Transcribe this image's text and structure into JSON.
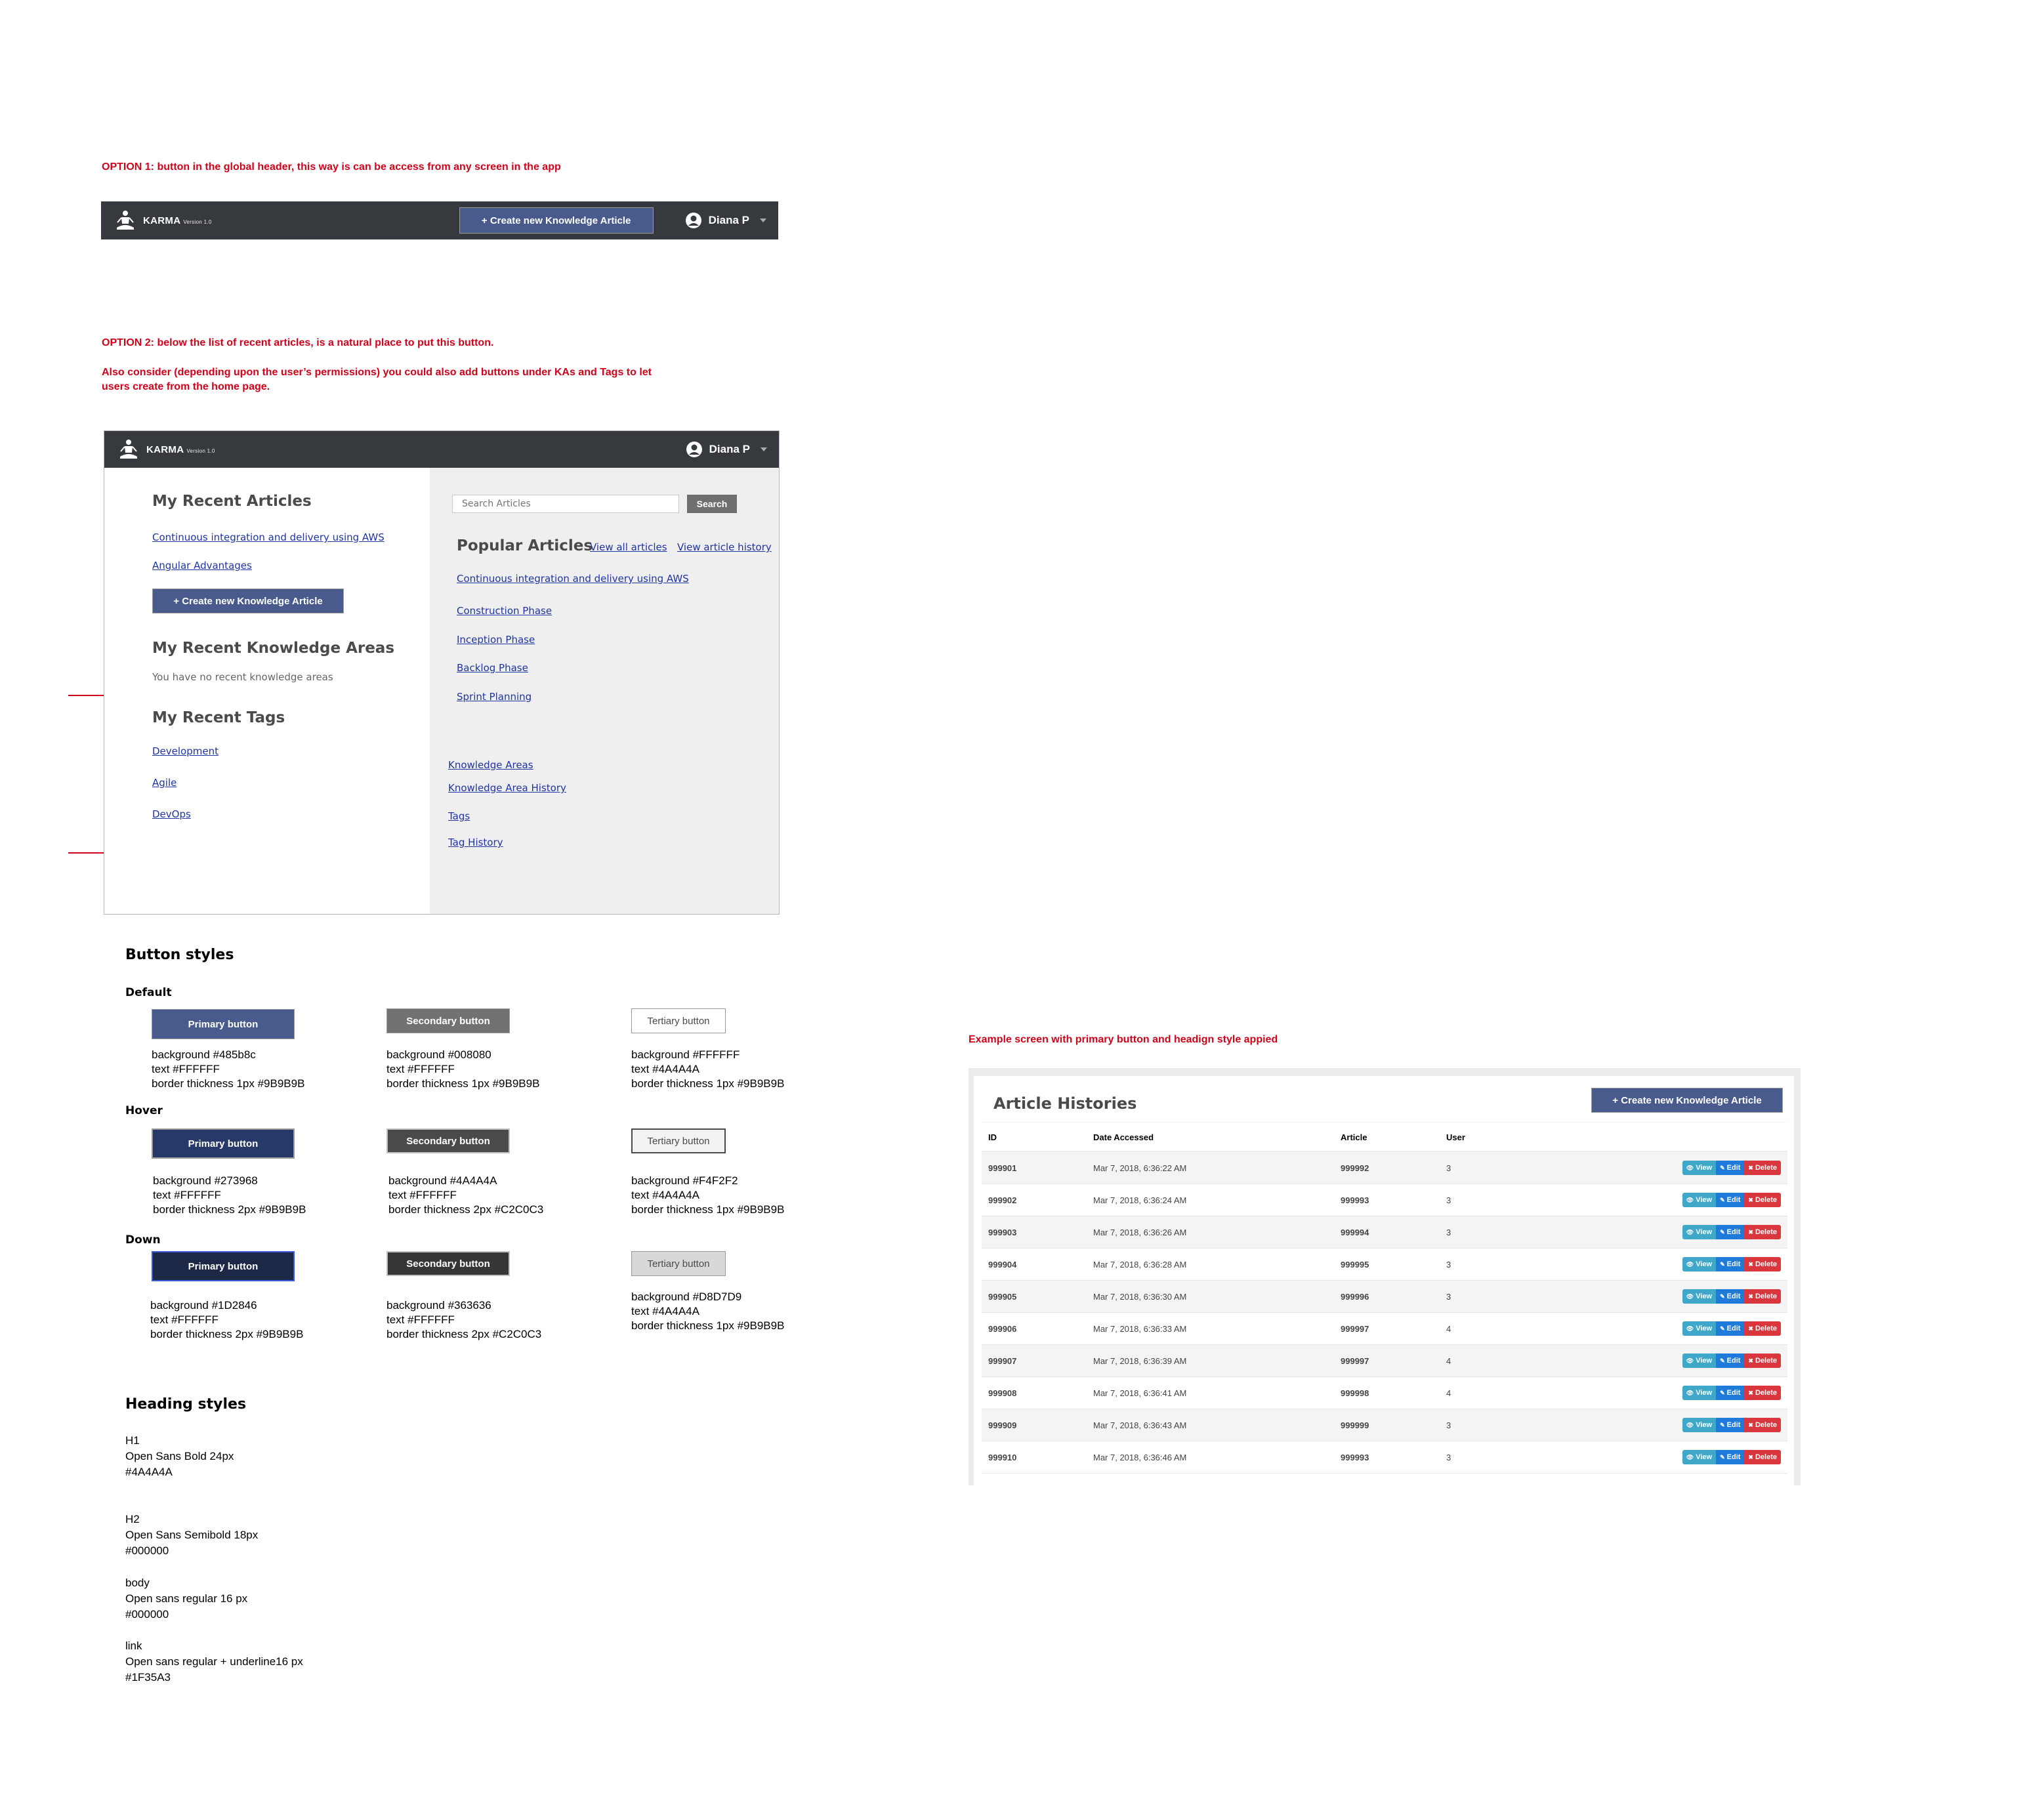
{
  "option1": {
    "note": "OPTION 1: button in the global header, this way is can be access from any screen in the app",
    "header": {
      "brand": "KARMA",
      "version": "Version 1.0",
      "create_button": "+ Create new Knowledge Article",
      "user_name": "Diana P"
    }
  },
  "option2": {
    "note_line1": "OPTION 2: below the list of recent articles, is a natural place to put this button.",
    "note_line2": "Also consider (depending upon the user’s permissions) you could also add buttons under KAs and Tags to let",
    "note_line3": "users create from the home page.",
    "header": {
      "brand": "KARMA",
      "version": "Version 1.0",
      "user_name": "Diana P"
    },
    "left": {
      "recent_articles_title": "My Recent Articles",
      "recent_articles": [
        "Continuous integration and delivery using AWS",
        "Angular Advantages"
      ],
      "create_button": "+ Create new Knowledge Article",
      "recent_areas_title": "My Recent Knowledge Areas",
      "recent_areas_empty": "You have no recent knowledge areas",
      "recent_tags_title": "My Recent Tags",
      "recent_tags": [
        "Development",
        "Agile",
        "DevOps"
      ]
    },
    "right": {
      "search_placeholder": "Search Articles",
      "search_button": "Search",
      "popular_title": "Popular Articles",
      "view_all": "View all articles",
      "view_history": "View article history",
      "popular_articles": [
        "Continuous integration and delivery using AWS",
        "Construction Phase",
        "Inception Phase",
        "Backlog Phase",
        "Sprint Planning"
      ],
      "footer_links": [
        "Knowledge Areas",
        "Knowledge Area History",
        "Tags",
        "Tag History"
      ]
    }
  },
  "button_styles": {
    "title": "Button styles",
    "states": [
      {
        "name": "Default",
        "primary": {
          "label": "Primary button",
          "spec": [
            "background #485b8c",
            "text #FFFFFF",
            "border thickness 1px #9B9B9B"
          ]
        },
        "secondary": {
          "label": "Secondary button",
          "spec": [
            "background #008080",
            "text #FFFFFF",
            "border thickness 1px #9B9B9B"
          ]
        },
        "tertiary": {
          "label": "Tertiary button",
          "spec": [
            "background #FFFFFF",
            "text #4A4A4A",
            "border thickness 1px #9B9B9B"
          ]
        }
      },
      {
        "name": "Hover",
        "primary": {
          "label": "Primary button",
          "spec": [
            "background #273968",
            "text #FFFFFF",
            "border thickness 2px #9B9B9B"
          ]
        },
        "secondary": {
          "label": "Secondary button",
          "spec": [
            "background #4A4A4A",
            "text #FFFFFF",
            "border thickness 2px #C2C0C3"
          ]
        },
        "tertiary": {
          "label": "Tertiary button",
          "spec": [
            "background #F4F2F2",
            "text #4A4A4A",
            "border thickness 1px #9B9B9B"
          ]
        }
      },
      {
        "name": "Down",
        "primary": {
          "label": "Primary button",
          "spec": [
            "background #1D2846",
            "text #FFFFFF",
            "border thickness 2px #9B9B9B"
          ]
        },
        "secondary": {
          "label": "Secondary button",
          "spec": [
            "background #363636",
            "text #FFFFFF",
            "border thickness 2px #C2C0C3"
          ]
        },
        "tertiary": {
          "label": "Tertiary button",
          "spec": [
            "background #D8D7D9",
            "text #4A4A4A",
            "border thickness 1px #9B9B9B"
          ]
        }
      }
    ]
  },
  "heading_styles": {
    "title": "Heading styles",
    "items": [
      [
        "H1",
        "Open Sans Bold 24px",
        "#4A4A4A"
      ],
      [
        "H2",
        "Open Sans Semibold 18px",
        "#000000"
      ],
      [
        "body",
        "Open sans regular 16 px",
        "#000000"
      ],
      [
        "link",
        "Open sans regular + underline16 px",
        "#1F35A3"
      ]
    ]
  },
  "example": {
    "note": "Example screen with primary button and headign style appied",
    "title": "Article Histories",
    "create_button": "+ Create new Knowledge Article",
    "columns": [
      "ID",
      "Date Accessed",
      "Article",
      "User"
    ],
    "rows": [
      [
        "999901",
        "Mar 7, 2018, 6:36:22 AM",
        "999992",
        "3"
      ],
      [
        "999902",
        "Mar 7, 2018, 6:36:24 AM",
        "999993",
        "3"
      ],
      [
        "999903",
        "Mar 7, 2018, 6:36:26 AM",
        "999994",
        "3"
      ],
      [
        "999904",
        "Mar 7, 2018, 6:36:28 AM",
        "999995",
        "3"
      ],
      [
        "999905",
        "Mar 7, 2018, 6:36:30 AM",
        "999996",
        "3"
      ],
      [
        "999906",
        "Mar 7, 2018, 6:36:33 AM",
        "999997",
        "4"
      ],
      [
        "999907",
        "Mar 7, 2018, 6:36:39 AM",
        "999997",
        "4"
      ],
      [
        "999908",
        "Mar 7, 2018, 6:36:41 AM",
        "999998",
        "4"
      ],
      [
        "999909",
        "Mar 7, 2018, 6:36:43 AM",
        "999999",
        "3"
      ],
      [
        "999910",
        "Mar 7, 2018, 6:36:46 AM",
        "999993",
        "3"
      ]
    ],
    "actions": {
      "view": "View",
      "edit": "Edit",
      "delete": "Delete"
    }
  },
  "colors": {
    "header_bg": "#363a3f",
    "primary": "#485b8c",
    "note_red": "#d0021b",
    "link": "#1f35a3"
  }
}
